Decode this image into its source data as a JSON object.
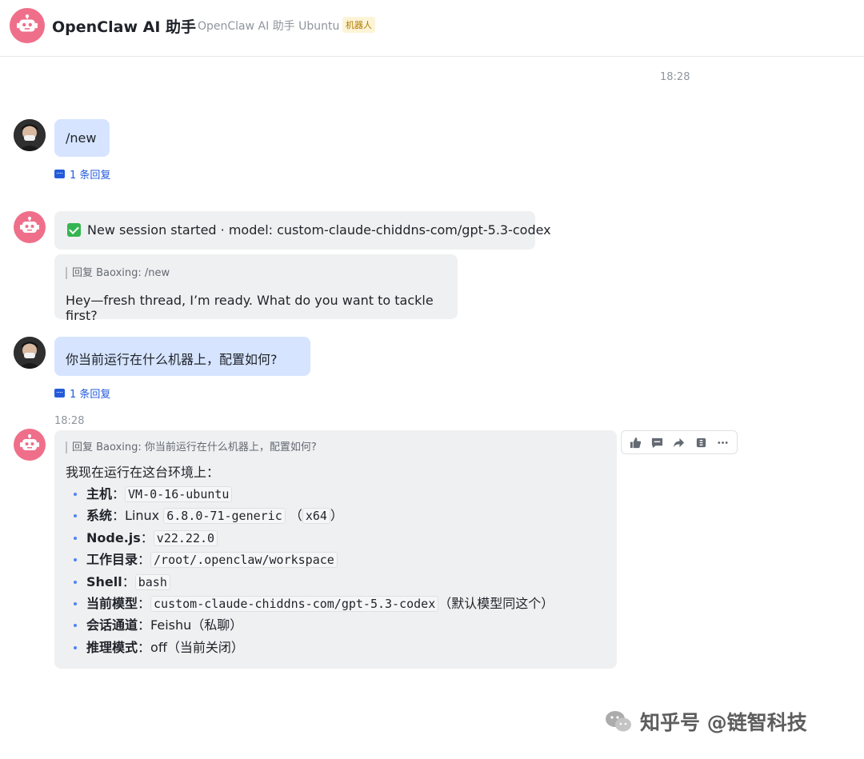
{
  "header": {
    "title": "OpenClaw AI 助手",
    "subtitle": "OpenClaw AI 助手 Ubuntu",
    "badge": "机器人"
  },
  "messages": {
    "time1": "18:28",
    "msg1": {
      "text": "/new",
      "reply_count": "1 条回复"
    },
    "msg2": {
      "status_text": "New session started · model: custom-claude-chiddns-com/gpt-5.3-codex",
      "quote": "回复 Baoxing: /new",
      "reply_text": "Hey—fresh thread, I’m ready. What do you want to tackle first?"
    },
    "msg3": {
      "text": "你当前运行在什么机器上，配置如何?",
      "reply_count": "1 条回复"
    },
    "time2": "18:28",
    "msg4": {
      "quote": "回复 Baoxing: 你当前运行在什么机器上，配置如何?",
      "intro": "我现在运行在这台环境上：",
      "items": [
        {
          "label": "主机",
          "sep": "：",
          "code": "VM-0-16-ubuntu",
          "after": ""
        },
        {
          "label": "系统",
          "sep": "：",
          "text": "Linux ",
          "code": "6.8.0-71-generic",
          "mid": " （",
          "code2": "x64",
          "after": "）"
        },
        {
          "label": "Node.js",
          "sep": "：",
          "code": "v22.22.0",
          "after": ""
        },
        {
          "label": "工作目录",
          "sep": "：",
          "code": "/root/.openclaw/workspace",
          "after": ""
        },
        {
          "label": "Shell",
          "sep": "：",
          "code": "bash",
          "after": ""
        },
        {
          "label": "当前模型",
          "sep": "：",
          "code": "custom-claude-chiddns-com/gpt-5.3-codex",
          "after": "（默认模型同这个）"
        },
        {
          "label": "会话通道",
          "sep": "：",
          "text": "Feishu（私聊）"
        },
        {
          "label": "推理模式",
          "sep": "：",
          "text": "off（当前关闭）"
        }
      ]
    }
  },
  "actions": [
    "thumbs-up-icon",
    "comment-icon",
    "forward-icon",
    "more-actions-icon",
    "ellipsis-icon"
  ],
  "watermark": "知乎号 @链智科技",
  "colors": {
    "bot_avatar": "#ef6f8a",
    "user_bubble": "#d6e4ff",
    "bot_bubble": "#eff0f1",
    "link": "#245bdb"
  }
}
